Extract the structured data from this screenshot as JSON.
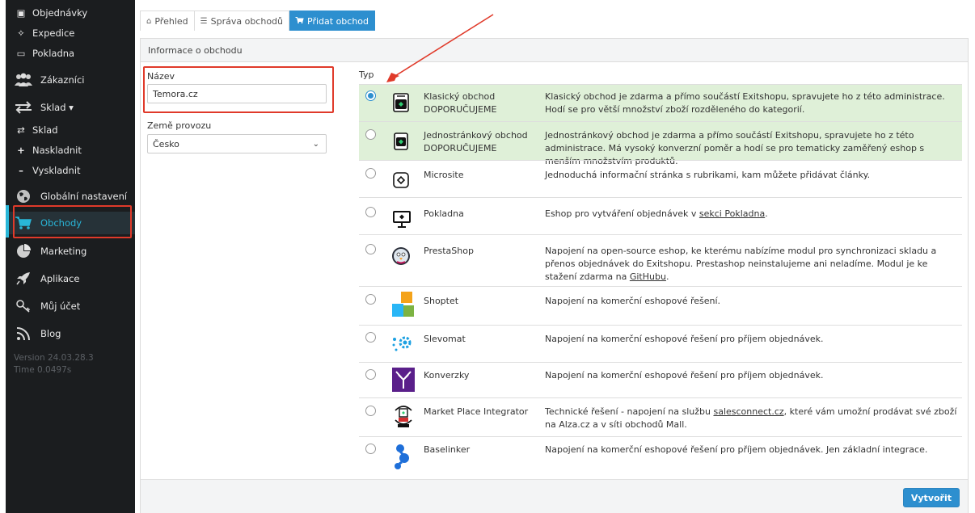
{
  "sidebar": {
    "items": [
      {
        "label": "Objednávky",
        "icon": "orders-icon"
      },
      {
        "label": "Expedice",
        "icon": "dispatch-icon"
      },
      {
        "label": "Pokladna",
        "icon": "register-icon"
      },
      {
        "label": "Zákazníci",
        "icon": "customers-icon"
      },
      {
        "label": "Sklad ▾",
        "icon": "warehouse-icon"
      },
      {
        "label": "Sklad",
        "icon": "swap-icon"
      },
      {
        "label": "Naskladnit",
        "icon": "plus-icon"
      },
      {
        "label": "Vyskladnit",
        "icon": "minus-icon"
      },
      {
        "label": "Globální nastavení",
        "icon": "globe-icon"
      },
      {
        "label": "Obchody",
        "icon": "cart-icon"
      },
      {
        "label": "Marketing",
        "icon": "pie-chart-icon"
      },
      {
        "label": "Aplikace",
        "icon": "rocket-icon"
      },
      {
        "label": "Můj účet",
        "icon": "key-icon"
      },
      {
        "label": "Blog",
        "icon": "rss-icon"
      }
    ],
    "version": "Version 24.03.28.3",
    "time": "Time 0.0497s"
  },
  "tabs": [
    {
      "label": "Přehled",
      "icon": "home-icon"
    },
    {
      "label": "Správa obchodů",
      "icon": "list-icon"
    },
    {
      "label": "Přidat obchod",
      "icon": "cart-icon"
    }
  ],
  "panel": {
    "title": "Informace o obchodu",
    "name_label": "Název",
    "name_value": "Temora.cz",
    "country_label": "Země provozu",
    "country_value": "Česko",
    "type_label": "Typ",
    "create_button": "Vytvořit"
  },
  "types": [
    {
      "name": "Klasický obchod",
      "tag": "DOPORUČUJEME",
      "desc": "Klasický obchod je zdarma a přímo součástí Exitshopu, spravujete ho z této administrace. Hodí se pro větší množství zboží rozděleného do kategorií."
    },
    {
      "name": "Jednostránkový obchod",
      "tag": "DOPORUČUJEME",
      "desc": "Jednostránkový obchod je zdarma a přímo součástí Exitshopu, spravujete ho z této administrace. Má vysoký konverzní poměr a hodí se pro tematicky zaměřený eshop s menším množstvím produktů."
    },
    {
      "name": "Microsite",
      "desc": "Jednoduchá informační stránka s rubrikami, kam můžete přidávat články."
    },
    {
      "name": "Pokladna",
      "desc_pre": "Eshop pro vytváření objednávek v ",
      "desc_link": "sekci Pokladna",
      "desc_post": "."
    },
    {
      "name": "PrestaShop",
      "desc_pre": "Napojení na open-source eshop, ke kterému nabízíme modul pro synchronizaci skladu a přenos objednávek do Exitshopu. Prestashop neinstalujeme ani neladíme. Modul je ke stažení zdarma na ",
      "desc_link": "GitHubu",
      "desc_post": "."
    },
    {
      "name": "Shoptet",
      "desc": "Napojení na komerční eshopové řešení."
    },
    {
      "name": "Slevomat",
      "desc": "Napojení na komerční eshopové řešení pro příjem objednávek."
    },
    {
      "name": "Konverzky",
      "desc": "Napojení na komerční eshopové řešení pro příjem objednávek."
    },
    {
      "name": "Market Place Integrator",
      "desc_pre": "Technické řešení - napojení na službu ",
      "desc_link": "salesconnect.cz",
      "desc_post": ", které vám umožní prodávat své zboží na Alza.cz a v síti obchodů Mall."
    },
    {
      "name": "Baselinker",
      "desc": "Napojení na komerční eshopové řešení pro příjem objednávek. Jen základní integrace."
    }
  ],
  "colors": {
    "sidebar_bg": "#1b1d1f",
    "accent": "#2d8fcf",
    "recommended_bg": "#dff0d8",
    "annotation_red": "#e03a2a"
  }
}
